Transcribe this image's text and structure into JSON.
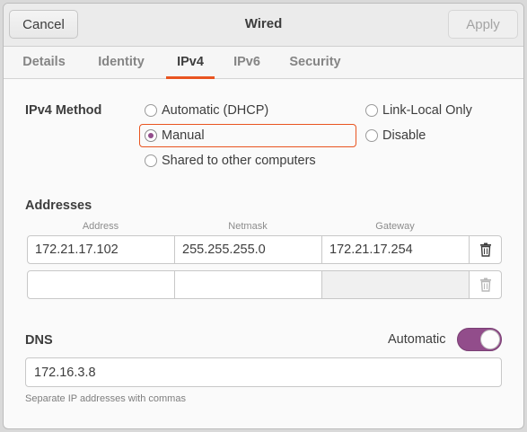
{
  "window": {
    "title": "Wired"
  },
  "header": {
    "cancel_label": "Cancel",
    "apply_label": "Apply"
  },
  "tabs": [
    {
      "label": "Details"
    },
    {
      "label": "Identity"
    },
    {
      "label": "IPv4",
      "active": true
    },
    {
      "label": "IPv6"
    },
    {
      "label": "Security"
    }
  ],
  "ipv4_method": {
    "label": "IPv4 Method",
    "options": [
      {
        "label": "Automatic (DHCP)",
        "checked": false
      },
      {
        "label": "Manual",
        "checked": true
      },
      {
        "label": "Shared to other computers",
        "checked": false
      },
      {
        "label": "Link-Local Only",
        "checked": false
      },
      {
        "label": "Disable",
        "checked": false
      }
    ]
  },
  "addresses": {
    "label": "Addresses",
    "columns": [
      "Address",
      "Netmask",
      "Gateway"
    ],
    "rows": [
      {
        "address": "172.21.17.102",
        "netmask": "255.255.255.0",
        "gateway": "172.21.17.254"
      },
      {
        "address": "",
        "netmask": "",
        "gateway": ""
      }
    ]
  },
  "dns": {
    "label": "DNS",
    "automatic_label": "Automatic",
    "automatic_on": true,
    "value": "172.16.3.8",
    "hint": "Separate IP addresses with commas"
  },
  "colors": {
    "accent": "#e95420",
    "toggle": "#924d8b"
  }
}
